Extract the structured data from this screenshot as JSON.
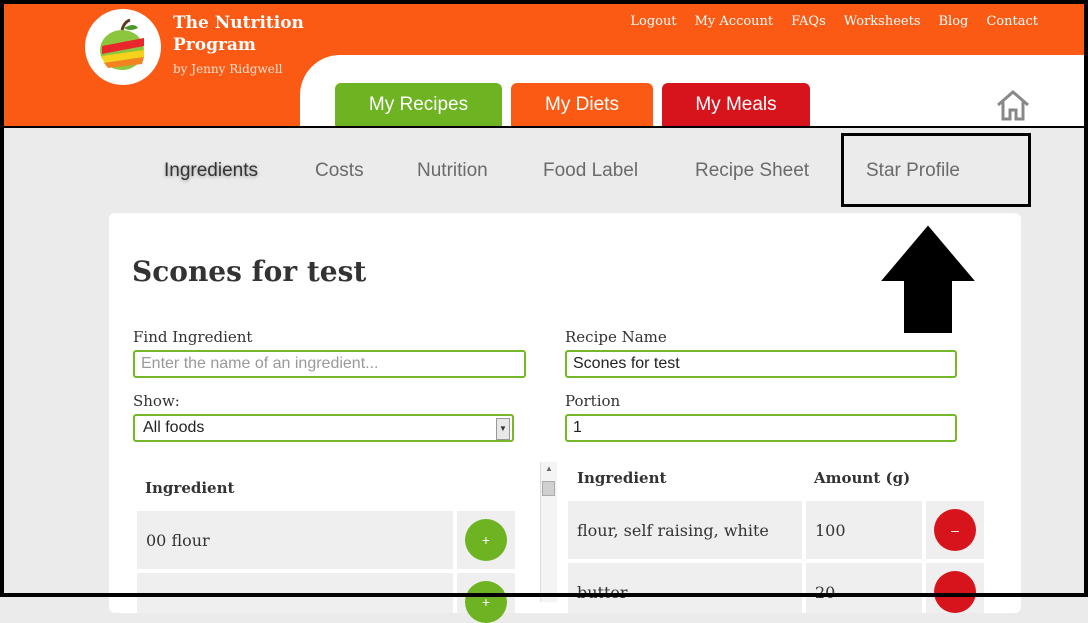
{
  "brand": {
    "line1": "The Nutrition",
    "line2": "Program",
    "byline": "by Jenny Ridgwell"
  },
  "topnav": [
    "Logout",
    "My Account",
    "FAQs",
    "Worksheets",
    "Blog",
    "Contact"
  ],
  "main_tabs": [
    {
      "label": "My Recipes",
      "color": "#6db322"
    },
    {
      "label": "My Diets",
      "color": "#fa5a14"
    },
    {
      "label": "My Meals",
      "color": "#d7141c"
    }
  ],
  "subnav": {
    "items": [
      "Ingredients",
      "Costs",
      "Nutrition",
      "Food Label",
      "Recipe Sheet",
      "Star Profile"
    ],
    "active": "Ingredients"
  },
  "recipe": {
    "title": "Scones for test",
    "find_label": "Find Ingredient",
    "find_placeholder": "Enter the name of an ingredient...",
    "name_label": "Recipe Name",
    "name_value": "Scones for test",
    "show_label": "Show:",
    "show_value": "All foods",
    "portion_label": "Portion",
    "portion_value": "1"
  },
  "search_list": {
    "header": "Ingredient",
    "rows": [
      {
        "name": "00 flour",
        "button": "+"
      },
      {
        "name": "",
        "button": "+"
      }
    ]
  },
  "recipe_list": {
    "headers": {
      "ingredient": "Ingredient",
      "amount": "Amount (g)"
    },
    "rows": [
      {
        "name": "flour, self raising, white",
        "amount": "100",
        "button": "–"
      },
      {
        "name": "butter",
        "amount": "20",
        "button": "–"
      }
    ]
  },
  "icons": {
    "home": "home-icon",
    "logo": "apple-logo-icon",
    "callout": "up-arrow-icon"
  },
  "colors": {
    "orange": "#fa5a14",
    "green": "#6db322",
    "red": "#d7141c"
  }
}
